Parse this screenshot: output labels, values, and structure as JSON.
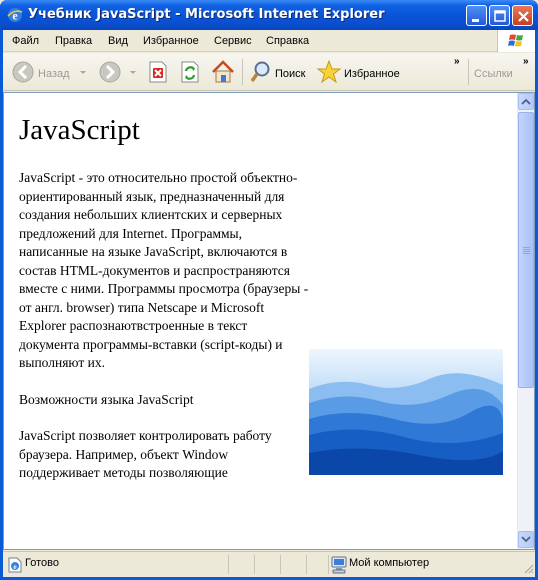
{
  "window": {
    "title": "Учебник JavaScript - Microsoft Internet Explorer"
  },
  "menu": {
    "items": [
      {
        "label": "Файл"
      },
      {
        "label": "Правка"
      },
      {
        "label": "Вид"
      },
      {
        "label": "Избранное"
      },
      {
        "label": "Сервис"
      },
      {
        "label": "Справка"
      }
    ]
  },
  "toolbar": {
    "back_label": "Назад",
    "search_label": "Поиск",
    "favorites_label": "Избранное",
    "links_label": "Ссылки",
    "more_glyph": "»"
  },
  "page": {
    "heading": "JavaScript",
    "paragraphs": [
      "JavaScript - это относительно простой объектно-ориентированный язык, предназначенный для создания небольших клиентских и серверных предложений для Internet. Программы, написанные на языке JavaScript, включаются в состав HTML-документов и распространяются вместе с ними. Программы просмотра (браузеры - от англ. browser) типа Netscape и Microsoft Explorer распознаютвстроенные в текст документа программы-вставки (script-коды) и выполняют их.",
      "Возможности языка JavaScript",
      "JavaScript позволяет контролировать работу браузера. Например, объект Window поддерживает методы позволяющие"
    ]
  },
  "status": {
    "text": "Готово",
    "zone": "Мой компьютер"
  }
}
